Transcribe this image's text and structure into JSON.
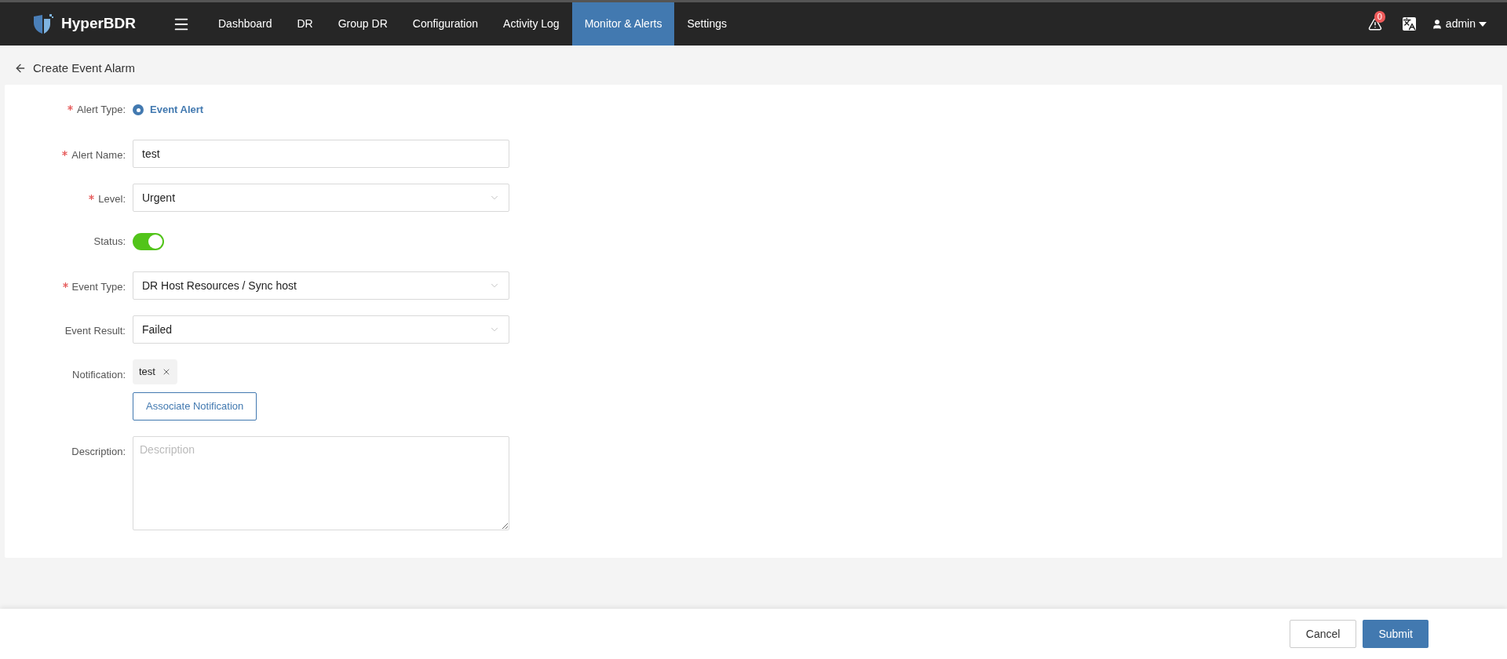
{
  "header": {
    "brand": "HyperBDR",
    "nav": [
      {
        "label": "Dashboard",
        "selected": false
      },
      {
        "label": "DR",
        "selected": false
      },
      {
        "label": "Group DR",
        "selected": false
      },
      {
        "label": "Configuration",
        "selected": false
      },
      {
        "label": "Activity Log",
        "selected": false
      },
      {
        "label": "Monitor & Alerts",
        "selected": true
      },
      {
        "label": "Settings",
        "selected": false
      }
    ],
    "alert_count": "0",
    "user": "admin"
  },
  "page_title": "Create Event Alarm",
  "form": [
    {
      "kind": "radio",
      "label": "Alert Type:",
      "required": true,
      "options": [
        {
          "label": "Event Alert",
          "selected": true
        }
      ]
    },
    {
      "kind": "input",
      "label": "Alert Name:",
      "required": true,
      "value": "test"
    },
    {
      "kind": "select",
      "label": "Level:",
      "required": true,
      "value": "Urgent"
    },
    {
      "kind": "switch",
      "label": "Status:",
      "required": false,
      "on": true
    },
    {
      "kind": "select",
      "label": "Event Type:",
      "required": true,
      "value": "DR Host Resources / Sync host"
    },
    {
      "kind": "select",
      "label": "Event Result:",
      "required": false,
      "value": "Failed"
    },
    {
      "kind": "tags",
      "label": "Notification:",
      "required": false,
      "tags": [
        "test"
      ],
      "button": "Associate Notification"
    },
    {
      "kind": "textarea",
      "label": "Description:",
      "required": false,
      "placeholder": "Description"
    }
  ],
  "footer": {
    "buttons": [
      "Cancel",
      "Submit"
    ]
  }
}
